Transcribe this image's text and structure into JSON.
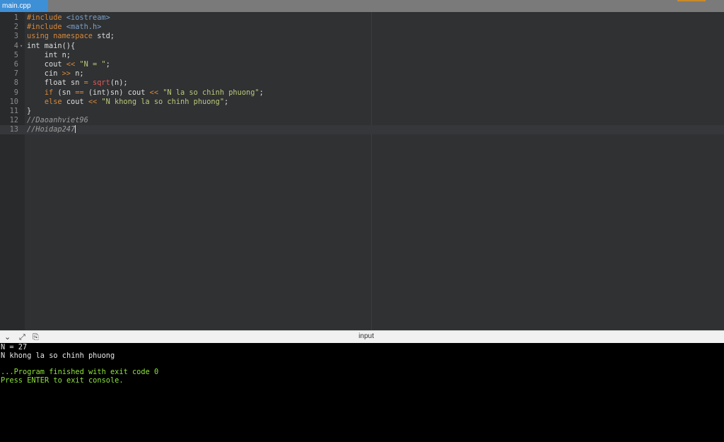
{
  "tab": {
    "label": "main.cpp"
  },
  "editor": {
    "lines": [
      {
        "num": "1",
        "parts": [
          {
            "t": "#include ",
            "c": "inc"
          },
          {
            "t": "<iostream>",
            "c": "hdr"
          }
        ]
      },
      {
        "num": "2",
        "parts": [
          {
            "t": "#include ",
            "c": "inc"
          },
          {
            "t": "<math.h>",
            "c": "hdr"
          }
        ]
      },
      {
        "num": "3",
        "parts": [
          {
            "t": "using ",
            "c": "kw"
          },
          {
            "t": "namespace ",
            "c": "kw"
          },
          {
            "t": "std;",
            "c": ""
          }
        ]
      },
      {
        "num": "4",
        "fold": true,
        "parts": [
          {
            "t": "int main(){",
            "c": ""
          }
        ]
      },
      {
        "num": "5",
        "parts": [
          {
            "t": "    int n;",
            "c": ""
          }
        ]
      },
      {
        "num": "6",
        "parts": [
          {
            "t": "    cout ",
            "c": ""
          },
          {
            "t": "<<",
            "c": "op"
          },
          {
            "t": " ",
            "c": ""
          },
          {
            "t": "\"N = \"",
            "c": "str"
          },
          {
            "t": ";",
            "c": ""
          }
        ]
      },
      {
        "num": "7",
        "parts": [
          {
            "t": "    cin ",
            "c": ""
          },
          {
            "t": ">>",
            "c": "op"
          },
          {
            "t": " n;",
            "c": ""
          }
        ]
      },
      {
        "num": "8",
        "parts": [
          {
            "t": "    float sn ",
            "c": ""
          },
          {
            "t": "=",
            "c": "op"
          },
          {
            "t": " ",
            "c": ""
          },
          {
            "t": "sqrt",
            "c": "fn"
          },
          {
            "t": "(n);",
            "c": ""
          }
        ]
      },
      {
        "num": "9",
        "parts": [
          {
            "t": "    ",
            "c": ""
          },
          {
            "t": "if",
            "c": "kw"
          },
          {
            "t": " (sn ",
            "c": ""
          },
          {
            "t": "==",
            "c": "op"
          },
          {
            "t": " (int)sn) cout ",
            "c": ""
          },
          {
            "t": "<<",
            "c": "op"
          },
          {
            "t": " ",
            "c": ""
          },
          {
            "t": "\"N la so chinh phuong\"",
            "c": "str"
          },
          {
            "t": ";",
            "c": ""
          }
        ]
      },
      {
        "num": "10",
        "parts": [
          {
            "t": "    ",
            "c": ""
          },
          {
            "t": "else",
            "c": "kw"
          },
          {
            "t": " cout ",
            "c": ""
          },
          {
            "t": "<<",
            "c": "op"
          },
          {
            "t": " ",
            "c": ""
          },
          {
            "t": "\"N khong la so chinh phuong\"",
            "c": "str"
          },
          {
            "t": ";",
            "c": ""
          }
        ]
      },
      {
        "num": "11",
        "parts": [
          {
            "t": "}",
            "c": ""
          }
        ]
      },
      {
        "num": "12",
        "parts": [
          {
            "t": "//Daoanhviet96",
            "c": "cmt"
          }
        ]
      },
      {
        "num": "13",
        "active": true,
        "cursor": true,
        "parts": [
          {
            "t": "//Hoidap247",
            "c": "cmt"
          }
        ]
      }
    ]
  },
  "splitter": {
    "label": "input"
  },
  "console": {
    "lines": [
      {
        "text": "N = 27",
        "color": "white"
      },
      {
        "text": "N khong la so chinh phuong",
        "color": "white"
      },
      {
        "text": "",
        "color": "white"
      },
      {
        "text": "...Program finished with exit code 0",
        "color": "green"
      },
      {
        "text": "Press ENTER to exit console.",
        "color": "green"
      }
    ]
  }
}
